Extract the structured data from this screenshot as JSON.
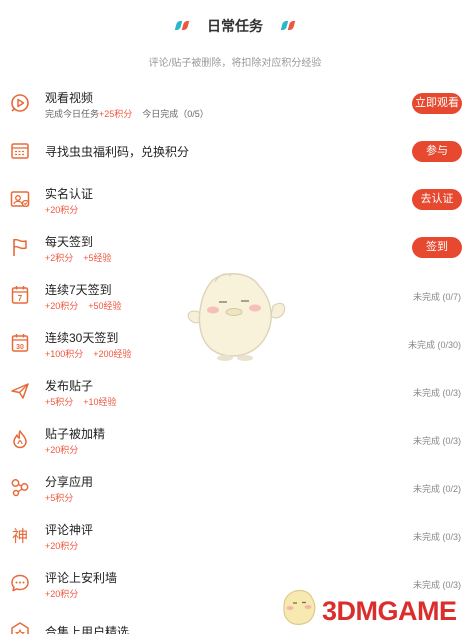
{
  "header": {
    "title": "日常任务",
    "notice": "评论/贴子被删除，将扣除对应积分经验"
  },
  "colors": {
    "accent": "#e6492f",
    "reward": "#f0553d",
    "deco_teal": "#2ab7c9"
  },
  "tasks": [
    {
      "icon": "play-circle-icon",
      "name": "观看视频",
      "sub_prefix": "完成今日任务",
      "reward1": "+25积分",
      "sub_extra": "今日完成（0/5）",
      "action": "立即观看",
      "status": ""
    },
    {
      "icon": "calendar-grid-icon",
      "name": "寻找虫虫福利码，兑换积分",
      "action": "参与",
      "status": ""
    },
    {
      "icon": "id-card-icon",
      "name": "实名认证",
      "reward1": "+20积分",
      "action": "去认证",
      "status": ""
    },
    {
      "icon": "flag-icon",
      "name": "每天签到",
      "reward1": "+2积分",
      "reward2": "+5经验",
      "action": "签到",
      "status": ""
    },
    {
      "icon": "calendar-7-icon",
      "name": "连续7天签到",
      "reward1": "+20积分",
      "reward2": "+50经验",
      "calendar_num": "7",
      "action": "",
      "status": "未完成 (0/7)"
    },
    {
      "icon": "calendar-30-icon",
      "name": "连续30天签到",
      "reward1": "+100积分",
      "reward2": "+200经验",
      "calendar_num": "30",
      "action": "",
      "status": "未完成 (0/30)"
    },
    {
      "icon": "paper-plane-icon",
      "name": "发布贴子",
      "reward1": "+5积分",
      "reward2": "+10经验",
      "action": "",
      "status": "未完成 (0/3)"
    },
    {
      "icon": "flame-icon",
      "name": "贴子被加精",
      "reward1": "+20积分",
      "action": "",
      "status": "未完成 (0/3)"
    },
    {
      "icon": "share-icon",
      "name": "分享应用",
      "reward1": "+5积分",
      "action": "",
      "status": "未完成 (0/2)"
    },
    {
      "icon": "god-character-icon",
      "name": "评论神评",
      "reward1": "+20积分",
      "glyph": "神",
      "action": "",
      "status": "未完成 (0/3)"
    },
    {
      "icon": "chat-bubble-icon",
      "name": "评论上安利墙",
      "reward1": "+20积分",
      "action": "",
      "status": "未完成 (0/3)"
    },
    {
      "icon": "star-box-icon",
      "name": "合集上用户精选",
      "action": "",
      "status": ""
    }
  ],
  "watermark": {
    "text": "3DMGAME"
  }
}
